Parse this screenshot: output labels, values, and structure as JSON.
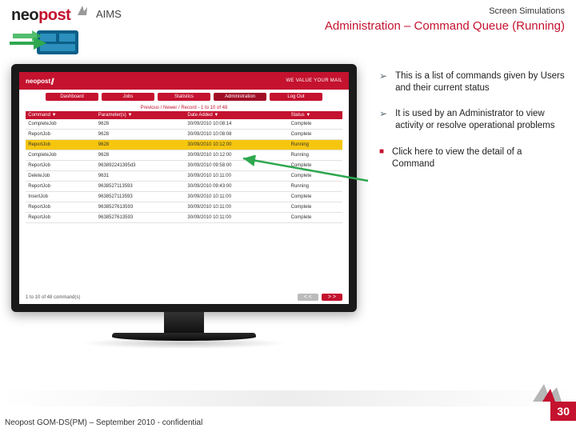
{
  "brand": {
    "name_a": "neo",
    "name_b": "post",
    "slogan": "WE VALUE YOUR MAIL"
  },
  "product": "AIMS",
  "supertitle": "Screen Simulations",
  "title": "Administration – Command Queue (Running)",
  "tabs": [
    "Dashboard",
    "Jobs",
    "Statistics",
    "Administration",
    "Log Out"
  ],
  "active_tab_index": 3,
  "subhead": "Previous / Newer / Record - 1 to 10 of 48",
  "table": {
    "headers": [
      "Command ▼",
      "Parameter(s) ▼",
      "Date Added ▼",
      "Status ▼"
    ],
    "rows": [
      {
        "c": [
          "CompleteJob",
          "9628",
          "30/09/2010 10:08:14",
          "Complete"
        ],
        "hl": false
      },
      {
        "c": [
          "ReportJob",
          "9628",
          "30/09/2010 10:08:08",
          "Complete"
        ],
        "hl": false
      },
      {
        "c": [
          "ReportJob",
          "9628",
          "30/09/2010 10:12:00",
          "Running"
        ],
        "hl": true
      },
      {
        "c": [
          "CompleteJob",
          "9628",
          "30/09/2010 10:12:00",
          "Running"
        ],
        "hl": false
      },
      {
        "c": [
          "ReportJob",
          "963892241395d3",
          "30/09/2010 09:58:00",
          "Complete"
        ],
        "hl": false
      },
      {
        "c": [
          "DeleteJob",
          "9631",
          "30/09/2010 10:11:00",
          "Complete"
        ],
        "hl": false
      },
      {
        "c": [
          "ReportJob",
          "9638527113593",
          "30/09/2010 09:43:00",
          "Running"
        ],
        "hl": false
      },
      {
        "c": [
          "InsertJob",
          "9638527113593",
          "30/09/2010 10:11:00",
          "Complete"
        ],
        "hl": false
      },
      {
        "c": [
          "ReportJob",
          "9638527613593",
          "30/09/2010 10:11:00",
          "Complete"
        ],
        "hl": false
      },
      {
        "c": [
          "ReportJob",
          "9638527613593",
          "30/09/2010 10:11:00",
          "Complete"
        ],
        "hl": false
      }
    ]
  },
  "pager": {
    "info": "1 to 10 of 48 command(s)",
    "prev": "< <",
    "next": "> >"
  },
  "notes": [
    {
      "type": "arrow",
      "text": "This is a list of commands given by Users and their current status"
    },
    {
      "type": "arrow",
      "text": "It is used by an Administrator to view activity or resolve operational problems"
    },
    {
      "type": "square",
      "text": "Click here to view the detail of a Command"
    }
  ],
  "footer": "Neopost GOM-DS(PM) – September 2010 - confidential",
  "page_number": "30"
}
